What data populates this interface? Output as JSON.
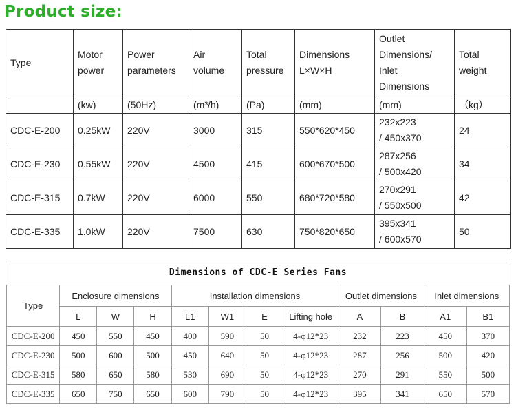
{
  "page_title": "Product size:",
  "table1": {
    "headers": [
      "Type",
      "Motor\npower",
      "Power\nparameters",
      "Air\nvolume",
      "Total\npressure",
      "Dimensions\nL×W×H",
      "Outlet\nDimensions/\nInlet\nDimensions",
      "Total\nweight"
    ],
    "units": [
      "",
      "(kw)",
      "(50Hz)",
      "(m³/h)",
      "(Pa)",
      "(mm)",
      "(mm)",
      "（kg）"
    ],
    "rows": [
      [
        "CDC-E-200",
        "0.25kW",
        "220V",
        "3000",
        "315",
        "550*620*450",
        "232x223\n/ 450x370",
        "24"
      ],
      [
        "CDC-E-230",
        "0.55kW",
        "220V",
        "4500",
        "415",
        "600*670*500",
        "287x256\n/ 500x420",
        "34"
      ],
      [
        "CDC-E-315",
        "0.7kW",
        "220V",
        "6000",
        "550",
        "680*720*580",
        "270x291\n/ 550x500",
        "42"
      ],
      [
        "CDC-E-335",
        "1.0kW",
        "220V",
        "7500",
        "630",
        "750*820*650",
        "395x341\n/ 600x570",
        "50"
      ]
    ]
  },
  "table2": {
    "caption": "Dimensions of CDC-E Series Fans",
    "type_label": "Type",
    "groups": [
      "Enclosure dimensions",
      "Installation dimensions",
      "Outlet dimensions",
      "Inlet dimensions"
    ],
    "subheaders": [
      "L",
      "W",
      "H",
      "L1",
      "W1",
      "E",
      "Lifting hole",
      "A",
      "B",
      "A1",
      "B1"
    ],
    "rows": [
      [
        "CDC-E-200",
        "450",
        "550",
        "450",
        "400",
        "590",
        "50",
        "4-φ12*23",
        "232",
        "223",
        "450",
        "370"
      ],
      [
        "CDC-E-230",
        "500",
        "600",
        "500",
        "450",
        "640",
        "50",
        "4-φ12*23",
        "287",
        "256",
        "500",
        "420"
      ],
      [
        "CDC-E-315",
        "580",
        "650",
        "580",
        "530",
        "690",
        "50",
        "4-φ12*23",
        "270",
        "291",
        "550",
        "500"
      ],
      [
        "CDC-E-335",
        "650",
        "750",
        "650",
        "600",
        "790",
        "50",
        "4-φ12*23",
        "395",
        "341",
        "650",
        "570"
      ]
    ]
  }
}
